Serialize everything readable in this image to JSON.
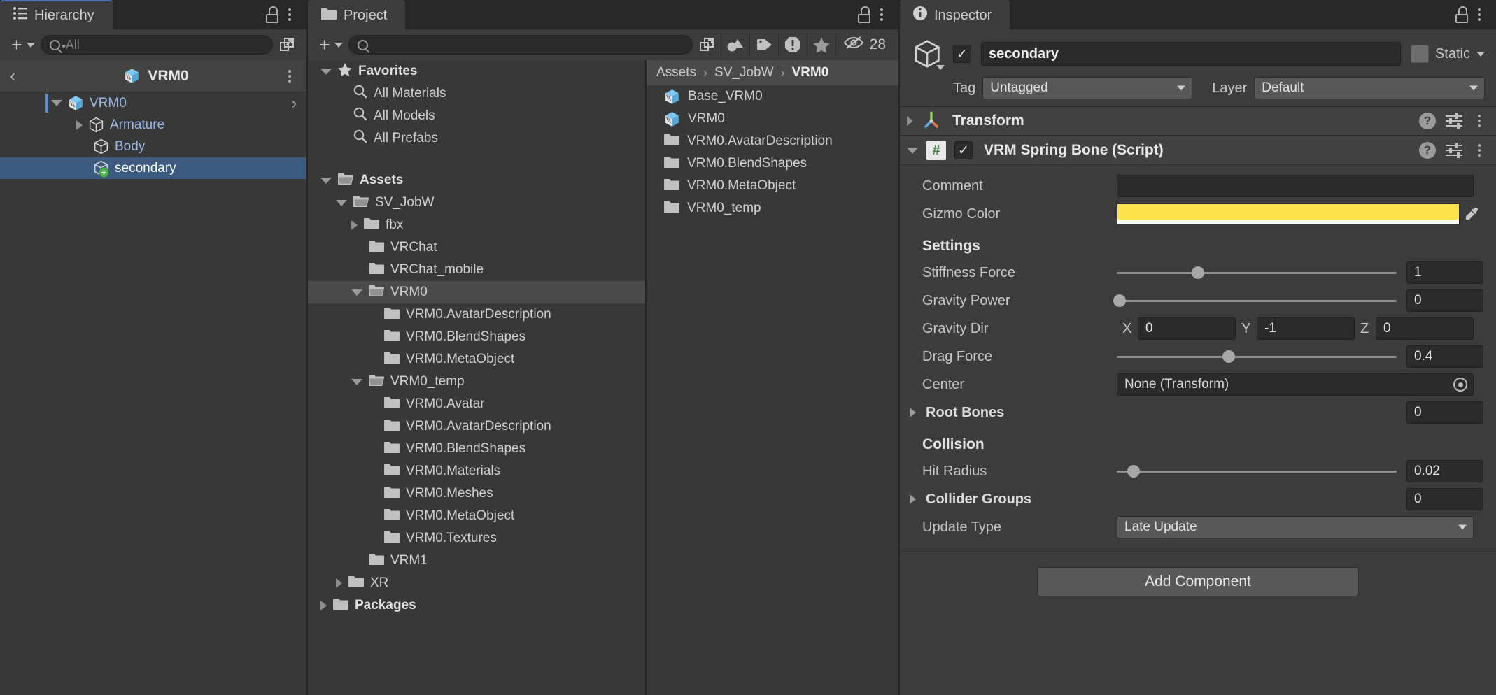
{
  "hierarchy": {
    "tab_label": "Hierarchy",
    "tab_icon": "hierarchy-icon",
    "lock_icon": "lock-icon",
    "menu_icon": "kebab-menu-icon",
    "add_label": "+",
    "search_placeholder": "All",
    "search_value": "",
    "breadcrumb": {
      "back_glyph": "‹",
      "title": "VRM0"
    },
    "items": [
      {
        "label": "VRM0",
        "depth": 1,
        "expanded": true,
        "icon": "prefab-cube-icon",
        "selected": false,
        "has_children": true,
        "color": "blue",
        "chevron": "›"
      },
      {
        "label": "Armature",
        "depth": 2,
        "expanded": false,
        "icon": "gameobject-cube-icon",
        "selected": false,
        "has_children": true,
        "color": "blue"
      },
      {
        "label": "Body",
        "depth": 2,
        "expanded": null,
        "icon": "gameobject-cube-icon",
        "selected": false,
        "has_children": false,
        "color": "blue"
      },
      {
        "label": "secondary",
        "depth": 2,
        "expanded": null,
        "icon": "gameobject-added-cube-icon",
        "selected": true,
        "has_children": false,
        "color": "white"
      }
    ]
  },
  "project": {
    "tab_label": "Project",
    "tab_icon": "folder-icon",
    "lock_icon": "lock-icon",
    "menu_icon": "kebab-menu-icon",
    "add_label": "+",
    "search_placeholder": "",
    "search_value": "",
    "toolbar_icons": [
      {
        "name": "save-search-icon"
      },
      {
        "name": "asset-type-filter-icon"
      },
      {
        "name": "label-filter-icon"
      },
      {
        "name": "warning-filter-icon"
      },
      {
        "name": "favorite-filter-icon"
      }
    ],
    "hidden_count": "28",
    "hidden_icon": "eye-off-icon",
    "tree": [
      {
        "label": "Favorites",
        "depth": 0,
        "bold": true,
        "icon": "star-icon",
        "expanded": true
      },
      {
        "label": "All Materials",
        "depth": 1,
        "bold": false,
        "icon": "search-icon",
        "expanded": null
      },
      {
        "label": "All Models",
        "depth": 1,
        "bold": false,
        "icon": "search-icon",
        "expanded": null
      },
      {
        "label": "All Prefabs",
        "depth": 1,
        "bold": false,
        "icon": "search-icon",
        "expanded": null
      },
      {
        "label": "",
        "depth": 0,
        "bold": false,
        "icon": "spacer",
        "expanded": null
      },
      {
        "label": "Assets",
        "depth": 0,
        "bold": true,
        "icon": "folder-open-icon",
        "expanded": true
      },
      {
        "label": "SV_JobW",
        "depth": 1,
        "bold": false,
        "icon": "folder-open-icon",
        "expanded": true
      },
      {
        "label": "fbx",
        "depth": 2,
        "bold": false,
        "icon": "folder-icon",
        "expanded": false
      },
      {
        "label": "VRChat",
        "depth": 2,
        "bold": false,
        "icon": "folder-icon",
        "expanded": null
      },
      {
        "label": "VRChat_mobile",
        "depth": 2,
        "bold": false,
        "icon": "folder-icon",
        "expanded": null
      },
      {
        "label": "VRM0",
        "depth": 2,
        "bold": false,
        "icon": "folder-open-icon",
        "expanded": true,
        "highlighted": true
      },
      {
        "label": "VRM0.AvatarDescription",
        "depth": 3,
        "bold": false,
        "icon": "folder-icon",
        "expanded": null
      },
      {
        "label": "VRM0.BlendShapes",
        "depth": 3,
        "bold": false,
        "icon": "folder-icon",
        "expanded": null
      },
      {
        "label": "VRM0.MetaObject",
        "depth": 3,
        "bold": false,
        "icon": "folder-icon",
        "expanded": null
      },
      {
        "label": "VRM0_temp",
        "depth": 2,
        "bold": false,
        "icon": "folder-open-icon",
        "expanded": true
      },
      {
        "label": "VRM0.Avatar",
        "depth": 3,
        "bold": false,
        "icon": "folder-icon",
        "expanded": null
      },
      {
        "label": "VRM0.AvatarDescription",
        "depth": 3,
        "bold": false,
        "icon": "folder-icon",
        "expanded": null
      },
      {
        "label": "VRM0.BlendShapes",
        "depth": 3,
        "bold": false,
        "icon": "folder-icon",
        "expanded": null
      },
      {
        "label": "VRM0.Materials",
        "depth": 3,
        "bold": false,
        "icon": "folder-icon",
        "expanded": null
      },
      {
        "label": "VRM0.Meshes",
        "depth": 3,
        "bold": false,
        "icon": "folder-icon",
        "expanded": null
      },
      {
        "label": "VRM0.MetaObject",
        "depth": 3,
        "bold": false,
        "icon": "folder-icon",
        "expanded": null
      },
      {
        "label": "VRM0.Textures",
        "depth": 3,
        "bold": false,
        "icon": "folder-icon",
        "expanded": null
      },
      {
        "label": "VRM1",
        "depth": 2,
        "bold": false,
        "icon": "folder-icon",
        "expanded": null
      },
      {
        "label": "XR",
        "depth": 1,
        "bold": false,
        "icon": "folder-icon",
        "expanded": false
      },
      {
        "label": "Packages",
        "depth": 0,
        "bold": true,
        "icon": "folder-icon",
        "expanded": false
      }
    ],
    "breadcrumbs": [
      "Assets",
      "SV_JobW",
      "VRM0"
    ],
    "breadcrumb_sep": "›",
    "files": [
      {
        "label": "Base_VRM0",
        "icon": "prefab-cube-icon"
      },
      {
        "label": "VRM0",
        "icon": "prefab-cube-icon"
      },
      {
        "label": "VRM0.AvatarDescription",
        "icon": "folder-icon"
      },
      {
        "label": "VRM0.BlendShapes",
        "icon": "folder-icon"
      },
      {
        "label": "VRM0.MetaObject",
        "icon": "folder-icon"
      },
      {
        "label": "VRM0_temp",
        "icon": "folder-icon"
      }
    ]
  },
  "inspector": {
    "tab_label": "Inspector",
    "tab_icon": "info-icon",
    "lock_icon": "lock-icon",
    "menu_icon": "kebab-menu-icon",
    "gameobject": {
      "icon": "gameobject-cube-icon",
      "enabled": true,
      "enabled_glyph": "✓",
      "name": "secondary",
      "static_label": "Static",
      "static_checked": false,
      "tag_label": "Tag",
      "tag_value": "Untagged",
      "layer_label": "Layer",
      "layer_value": "Default"
    },
    "components": [
      {
        "name": "Transform",
        "icon": "transform-axis-icon",
        "expanded": false,
        "has_enable_toggle": false,
        "help_icon": "help-icon",
        "preset_icon": "preset-icon",
        "menu_icon": "kebab-menu-icon"
      },
      {
        "name": "VRM Spring Bone (Script)",
        "icon": "script-icon",
        "expanded": true,
        "has_enable_toggle": true,
        "enabled": true,
        "enabled_glyph": "✓",
        "help_icon": "help-icon",
        "preset_icon": "preset-icon",
        "menu_icon": "kebab-menu-icon"
      }
    ],
    "spring_bone": {
      "comment_label": "Comment",
      "comment_value": "",
      "gizmo_color_label": "Gizmo Color",
      "gizmo_color_value": "#FFE14D",
      "eyedropper_icon": "eyedropper-icon",
      "settings_title": "Settings",
      "stiffness_label": "Stiffness Force",
      "stiffness_value": "1",
      "stiffness_pct": 29,
      "gravity_power_label": "Gravity Power",
      "gravity_power_value": "0",
      "gravity_power_pct": 1,
      "gravity_dir_label": "Gravity Dir",
      "gravity_dir": {
        "x_label": "X",
        "x": "0",
        "y_label": "Y",
        "y": "-1",
        "z_label": "Z",
        "z": "0"
      },
      "drag_label": "Drag Force",
      "drag_value": "0.4",
      "drag_pct": 40,
      "center_label": "Center",
      "center_value": "None (Transform)",
      "root_bones_label": "Root Bones",
      "root_bones_count": "0",
      "collision_title": "Collision",
      "hit_radius_label": "Hit Radius",
      "hit_radius_value": "0.02",
      "hit_radius_pct": 6,
      "collider_groups_label": "Collider Groups",
      "collider_groups_count": "0",
      "update_type_label": "Update Type",
      "update_type_value": "Late Update"
    },
    "add_component_label": "Add Component"
  },
  "colors": {
    "selection_blue": "#3d5a80",
    "tab_accent": "#4b6eaf",
    "gizmo_yellow": "#FFE14D",
    "link_blue": "#9cb8e8",
    "panel_bg": "#383838",
    "inspector_bg": "#3c3c3c"
  }
}
